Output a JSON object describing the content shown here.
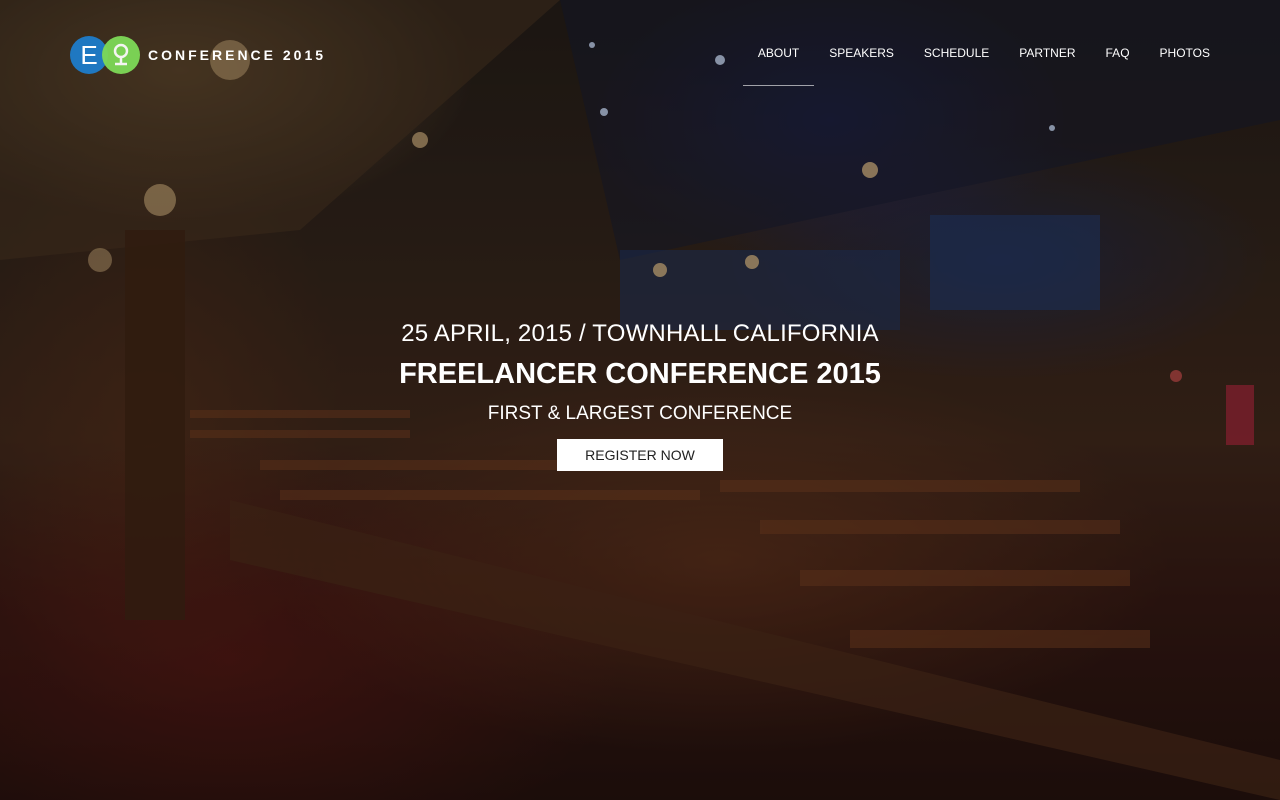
{
  "brand": {
    "logo_letter": "E",
    "name": "CONFERENCE 2015",
    "colors": {
      "blue": "#1f78c1",
      "green": "#7ed957"
    }
  },
  "nav": {
    "items": [
      {
        "label": "ABOUT",
        "active": true
      },
      {
        "label": "SPEAKERS",
        "active": false
      },
      {
        "label": "SCHEDULE",
        "active": false
      },
      {
        "label": "PARTNER",
        "active": false
      },
      {
        "label": "FAQ",
        "active": false
      },
      {
        "label": "PHOTOS",
        "active": false
      }
    ]
  },
  "hero": {
    "date_location": "25 APRIL, 2015 / TOWNHALL CALIFORNIA",
    "title": "FREELANCER CONFERENCE 2015",
    "subtitle": "FIRST & LARGEST CONFERENCE",
    "cta_label": "REGISTER NOW",
    "background": "theater-auditorium-photo"
  }
}
